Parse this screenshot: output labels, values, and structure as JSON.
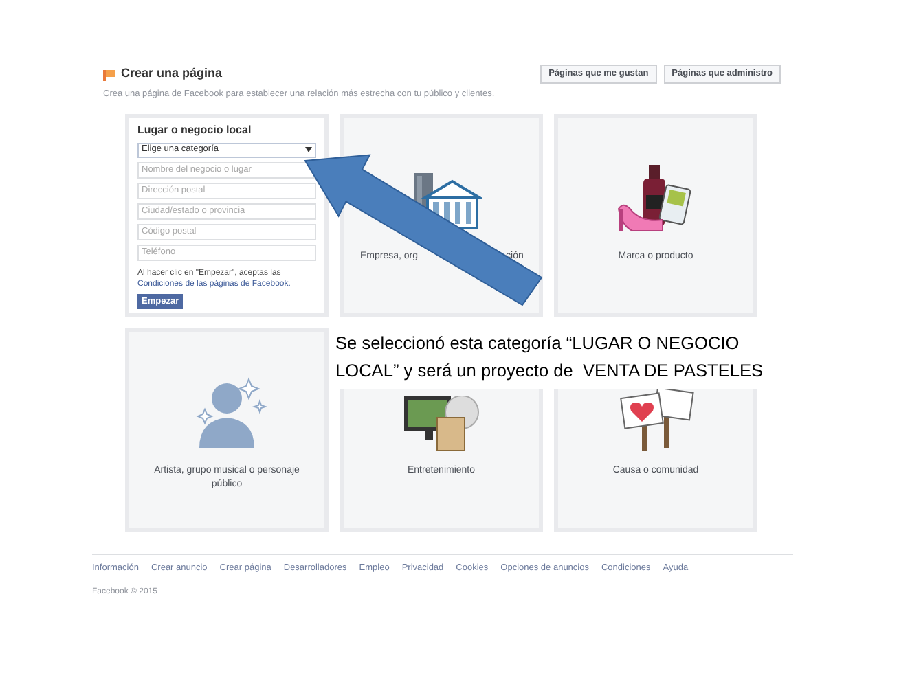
{
  "header": {
    "title": "Crear una página",
    "subtitle": "Crea una página de Facebook para establecer una relación más estrecha con tu público y clientes.",
    "buttons": [
      "Páginas que me gustan",
      "Páginas que administro"
    ]
  },
  "categories": [
    {
      "kind": "form",
      "title": "Lugar o negocio local",
      "select": "Elige una categoría",
      "fields": [
        {
          "placeholder": "Nombre del negocio o lugar"
        },
        {
          "placeholder": "Dirección postal"
        },
        {
          "placeholder": "Ciudad/estado o provincia"
        },
        {
          "placeholder": "Código postal"
        },
        {
          "placeholder": "Teléfono"
        }
      ],
      "terms": "Al hacer clic en \"Empezar\", aceptas las",
      "terms_link": "Condiciones de las páginas de Facebook.",
      "button": "Empezar"
    },
    {
      "kind": "split",
      "label_parts": [
        "Empresa, org",
        "ción"
      ]
    },
    {
      "kind": "category",
      "label": "Marca o producto"
    },
    {
      "kind": "category",
      "label": "Artista, grupo musical o personaje público"
    },
    {
      "kind": "category",
      "label": "Entretenimiento"
    },
    {
      "kind": "category",
      "label": "Causa o comunidad"
    }
  ],
  "footer": {
    "links": [
      "Información",
      "Crear anuncio",
      "Crear página",
      "Desarrolladores",
      "Empleo",
      "Privacidad",
      "Cookies",
      "Opciones de anuncios",
      "Condiciones",
      "Ayuda"
    ],
    "copyright": "Facebook © 2015"
  },
  "annotation": {
    "text": "Se seleccionó esta categoría “LUGAR O NEGOCIO LOCAL” y será un proyecto de  VENTA DE PASTELES"
  }
}
